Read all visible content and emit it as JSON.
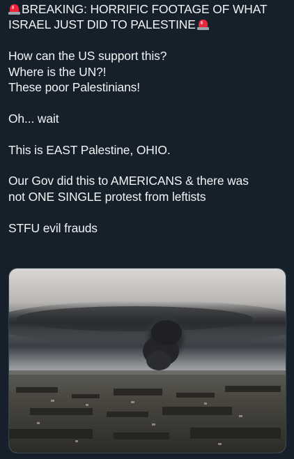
{
  "tweet": {
    "lines": [
      "BREAKING: HORRIFIC FOOTAGE OF WHAT",
      "ISRAEL JUST DID TO PALESTINE",
      "",
      "How can the US support this?",
      "Where is the UN?!",
      "These poor Palestinians!",
      "",
      "Oh... wait",
      "",
      "This is EAST Palestine, OHIO.",
      "",
      "Our Gov did this to AMERICANS & there was",
      "not ONE SINGLE protest from leftists",
      "",
      "STFU evil frauds"
    ],
    "emoji": "siren-icon"
  },
  "media": {
    "kind": "photo",
    "subject": "black smoke plume over town"
  },
  "colors": {
    "background": "#15202b",
    "text": "#f2f4f6",
    "siren": "#e8283a"
  }
}
